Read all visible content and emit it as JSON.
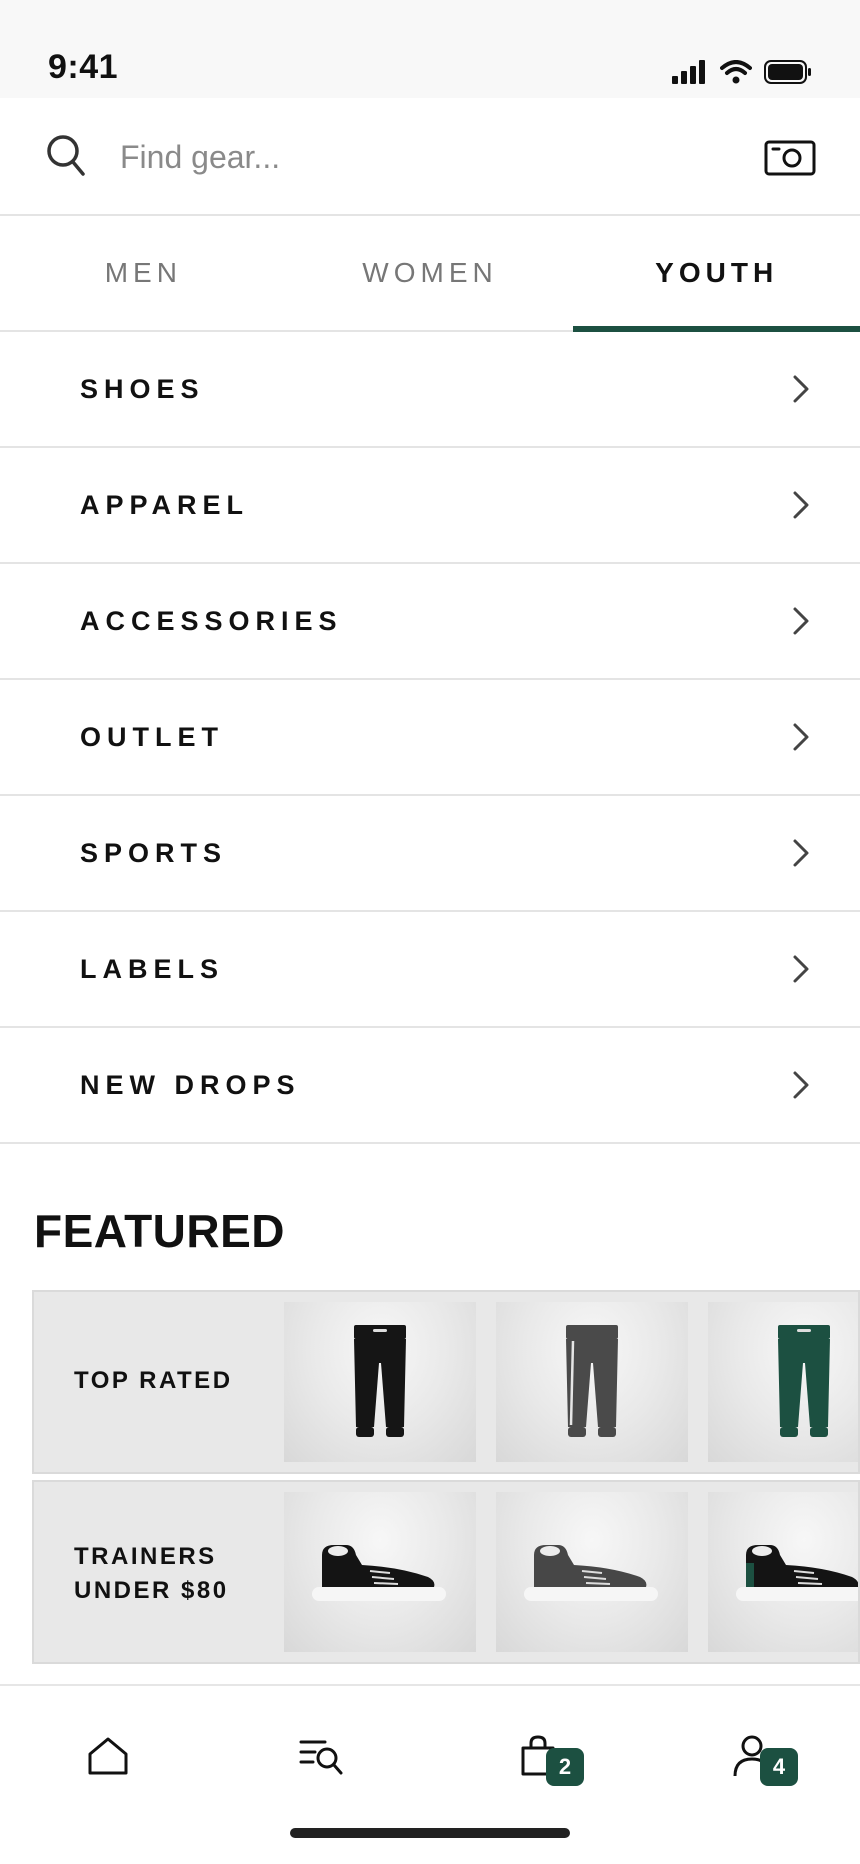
{
  "status_bar": {
    "time": "9:41",
    "icons": [
      "signal-icon",
      "wifi-icon",
      "battery-icon"
    ]
  },
  "search": {
    "placeholder": "Find gear...",
    "value": ""
  },
  "tabs": [
    {
      "label": "MEN",
      "active": false
    },
    {
      "label": "WOMEN",
      "active": false
    },
    {
      "label": "YOUTH",
      "active": true
    }
  ],
  "menu": {
    "items": [
      {
        "label": "SHOES"
      },
      {
        "label": "APPAREL"
      },
      {
        "label": "ACCESSORIES"
      },
      {
        "label": "OUTLET"
      },
      {
        "label": "SPORTS"
      },
      {
        "label": "LABELS"
      },
      {
        "label": "NEW DROPS"
      }
    ]
  },
  "featured": {
    "title": "FEATURED",
    "cards": [
      {
        "label": "TOP RATED",
        "products": [
          "pants-black",
          "pants-gray",
          "pants-green"
        ]
      },
      {
        "label": "TRAINERS UNDER $80",
        "label_lines": [
          "TRAINERS",
          "UNDER $80"
        ],
        "products": [
          "sneaker-black",
          "sneaker-gray",
          "sneaker-black-green"
        ]
      }
    ]
  },
  "bottom_nav": {
    "items": [
      {
        "icon": "home-icon"
      },
      {
        "icon": "browse-search-icon"
      },
      {
        "icon": "bag-icon",
        "badge": "2"
      },
      {
        "icon": "profile-icon",
        "badge": "4"
      }
    ]
  },
  "colors": {
    "accent": "#1c5041",
    "divider": "#e4e4e4",
    "card_bg": "#e8e8e8"
  }
}
